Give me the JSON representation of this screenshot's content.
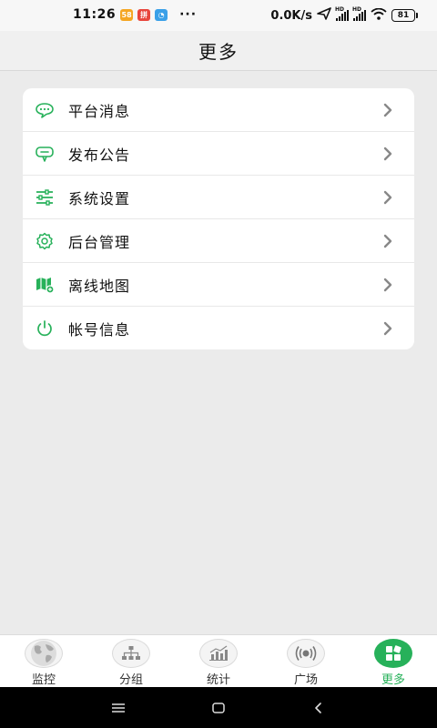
{
  "status_bar": {
    "time": "11:26",
    "app_icons": [
      {
        "name": "app-notify-icon",
        "text": "58",
        "color": "#f5a623"
      },
      {
        "name": "app-red-icon",
        "text": "拼",
        "color": "#e8453c"
      },
      {
        "name": "app-chat-icon",
        "text": "◔",
        "color": "#3aa0e8"
      }
    ],
    "overflow": "···",
    "net_speed": "0.0K/s",
    "hd1": "HD",
    "hd2": "HD",
    "battery": "81"
  },
  "header": {
    "title": "更多"
  },
  "menu": {
    "accent": "#27b15a",
    "items": [
      {
        "label": "平台消息",
        "icon": "message-icon"
      },
      {
        "label": "发布公告",
        "icon": "announcement-icon"
      },
      {
        "label": "系统设置",
        "icon": "sliders-icon"
      },
      {
        "label": "后台管理",
        "icon": "gear-icon"
      },
      {
        "label": "离线地图",
        "icon": "map-icon"
      },
      {
        "label": "帐号信息",
        "icon": "power-icon"
      }
    ]
  },
  "bottom_nav": {
    "items": [
      {
        "label": "监控",
        "icon": "globe-icon",
        "active": false
      },
      {
        "label": "分组",
        "icon": "org-chart-icon",
        "active": false
      },
      {
        "label": "统计",
        "icon": "bar-chart-icon",
        "active": false
      },
      {
        "label": "广场",
        "icon": "broadcast-icon",
        "active": false
      },
      {
        "label": "更多",
        "icon": "grid-icon",
        "active": true
      }
    ]
  }
}
